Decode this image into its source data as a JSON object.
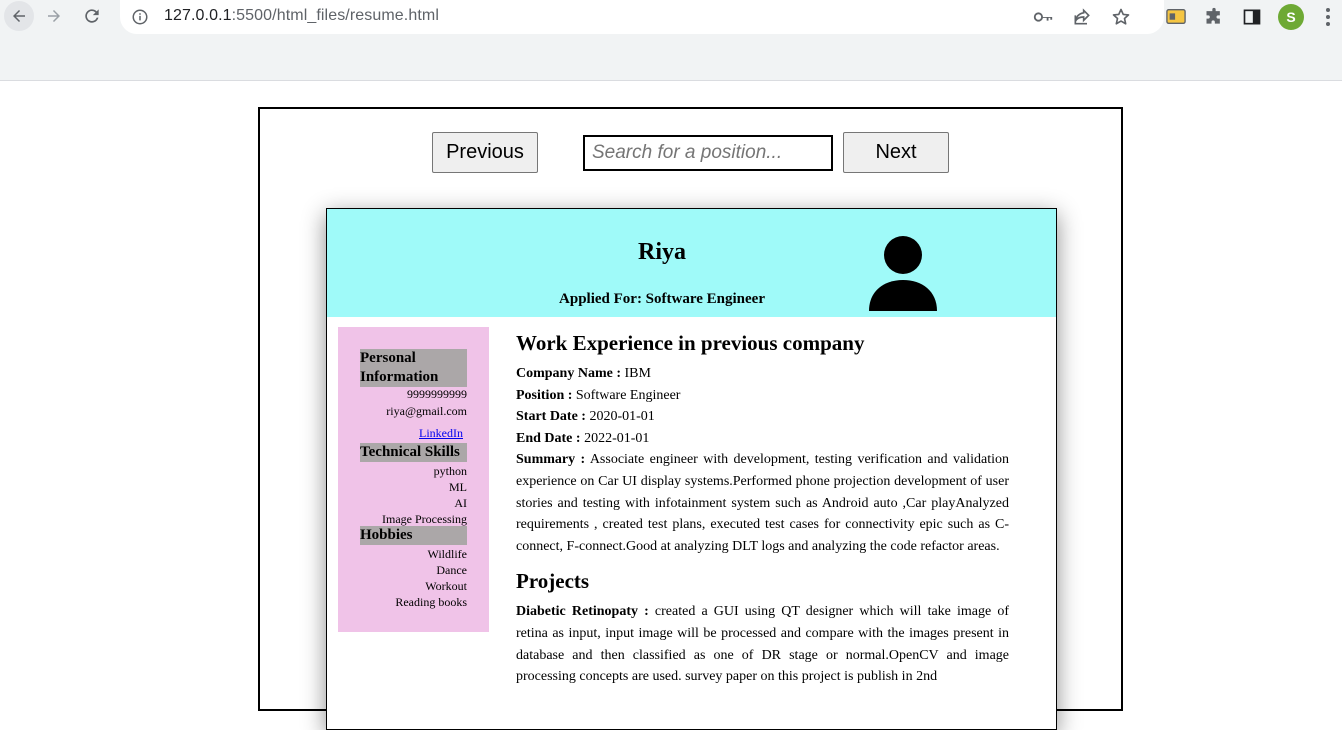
{
  "browser": {
    "url_host": "127.0.0.1",
    "url_rest": ":5500/html_files/resume.html",
    "avatar_letter": "S"
  },
  "nav": {
    "previous_label": "Previous",
    "next_label": "Next",
    "search_placeholder": "Search for a position..."
  },
  "resume": {
    "name": "Riya",
    "applied_for": "Applied For: Software Engineer",
    "sidebar": {
      "personal_title": "Personal Information",
      "phone": "9999999999",
      "email": "riya@gmail.com",
      "linkedin": "LinkedIn",
      "skills_title": "Technical Skills",
      "skills": [
        "python",
        "ML",
        "AI",
        "Image Processing"
      ],
      "hobbies_title": "Hobbies",
      "hobbies": [
        "Wildlife",
        "Dance",
        "Workout",
        "Reading books"
      ]
    },
    "work": {
      "heading": "Work Experience in previous company",
      "company_label": "Company Name :",
      "company": "IBM",
      "position_label": "Position :",
      "position": "Software Engineer",
      "start_label": "Start Date :",
      "start": "2020-01-01",
      "end_label": "End Date :",
      "end": "2022-01-01",
      "summary_label": "Summary :",
      "summary": "Associate engineer with development, testing verification and validation experience on Car UI display systems.Performed phone projection development of user stories and testing with infotainment system such as Android auto ,Car playAnalyzed requirements , created test plans, executed test cases for connectivity epic such as C-connect, F-connect.Good at analyzing DLT logs and analyzing the code refactor areas."
    },
    "projects": {
      "heading": "Projects",
      "project_label": "Diabetic Retinopaty :",
      "project_text": "created a GUI using QT designer which will take image of retina as input, input image will be processed and compare with the images present in database and then classified as one of DR stage or normal.OpenCV and image processing concepts are used. survey paper on this project is publish in 2nd"
    }
  }
}
